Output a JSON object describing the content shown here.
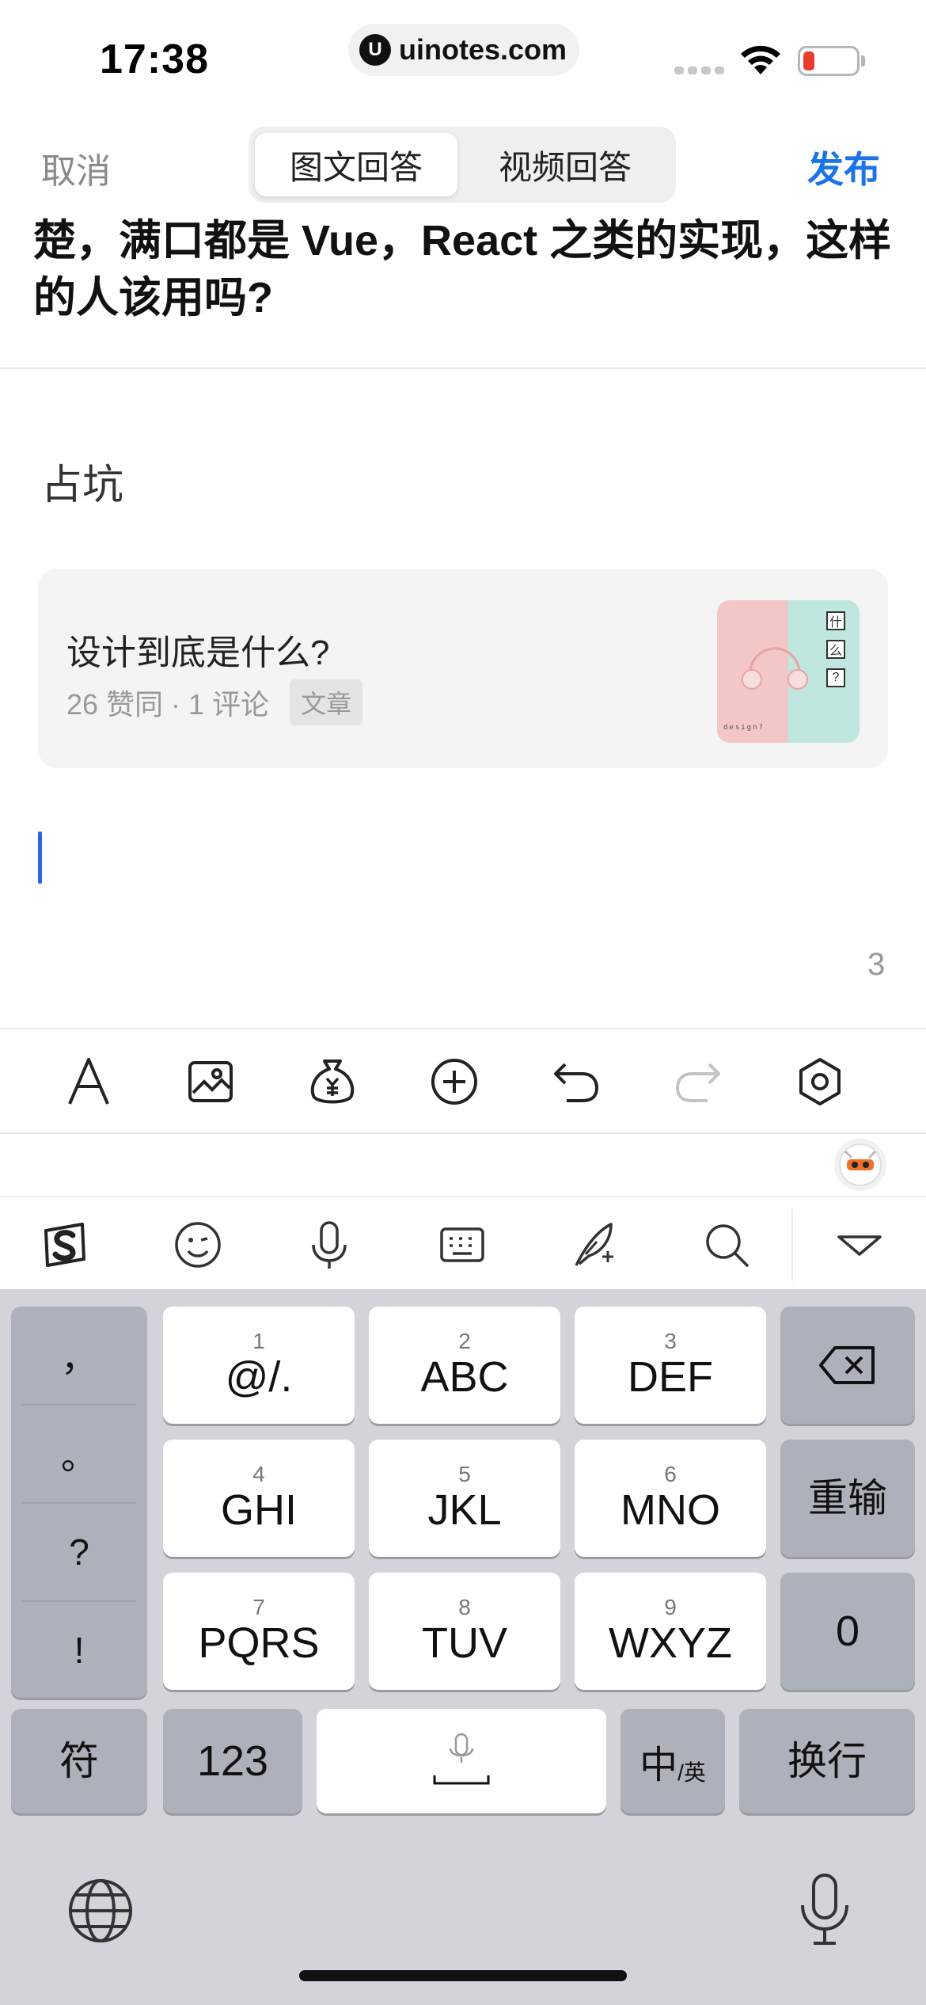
{
  "status_bar": {
    "time": "17:38",
    "url": "uinotes.com",
    "url_logo": "U",
    "battery_color": "#eb3b2f"
  },
  "nav": {
    "cancel_label": "取消",
    "tabs": [
      {
        "label": "图文回答",
        "active": true
      },
      {
        "label": "视频回答",
        "active": false
      }
    ],
    "publish_label": "发布",
    "accent_color": "#1a73e8"
  },
  "question": {
    "line1": "楚，满口都是 Vue，React 之类的实现，这样",
    "line2": "的人该用吗?"
  },
  "editor": {
    "answer_text": "占坑",
    "linked_card": {
      "title": "设计到底是什么?",
      "meta": "26 赞同 · 1 评论",
      "tag": "文章",
      "thumb_chars": [
        "什",
        "么",
        "?"
      ],
      "thumb_caption": "design?"
    },
    "char_count": "3"
  },
  "toolbar": {
    "icons": [
      "font-icon",
      "image-icon",
      "money-bag-icon",
      "add-circle-icon",
      "undo-icon",
      "redo-icon",
      "settings-hexagon-icon"
    ]
  },
  "ime_bar": {
    "icons": [
      "sogou-logo-icon",
      "emoji-icon",
      "voice-icon",
      "keyboard-icon",
      "handwriting-icon",
      "search-icon",
      "collapse-icon"
    ]
  },
  "keyboard": {
    "punctuation": [
      "，",
      "。",
      "?",
      "!"
    ],
    "keys": [
      {
        "num": "1",
        "label": "@/."
      },
      {
        "num": "2",
        "label": "ABC"
      },
      {
        "num": "3",
        "label": "DEF"
      },
      {
        "num": "4",
        "label": "GHI"
      },
      {
        "num": "5",
        "label": "JKL"
      },
      {
        "num": "6",
        "label": "MNO"
      },
      {
        "num": "7",
        "label": "PQRS"
      },
      {
        "num": "8",
        "label": "TUV"
      },
      {
        "num": "9",
        "label": "WXYZ"
      }
    ],
    "retype_label": "重输",
    "zero_label": "0",
    "symbol_label": "符",
    "numeric_label": "123",
    "lang_main": "中",
    "lang_sub": "/英",
    "return_label": "换行"
  }
}
